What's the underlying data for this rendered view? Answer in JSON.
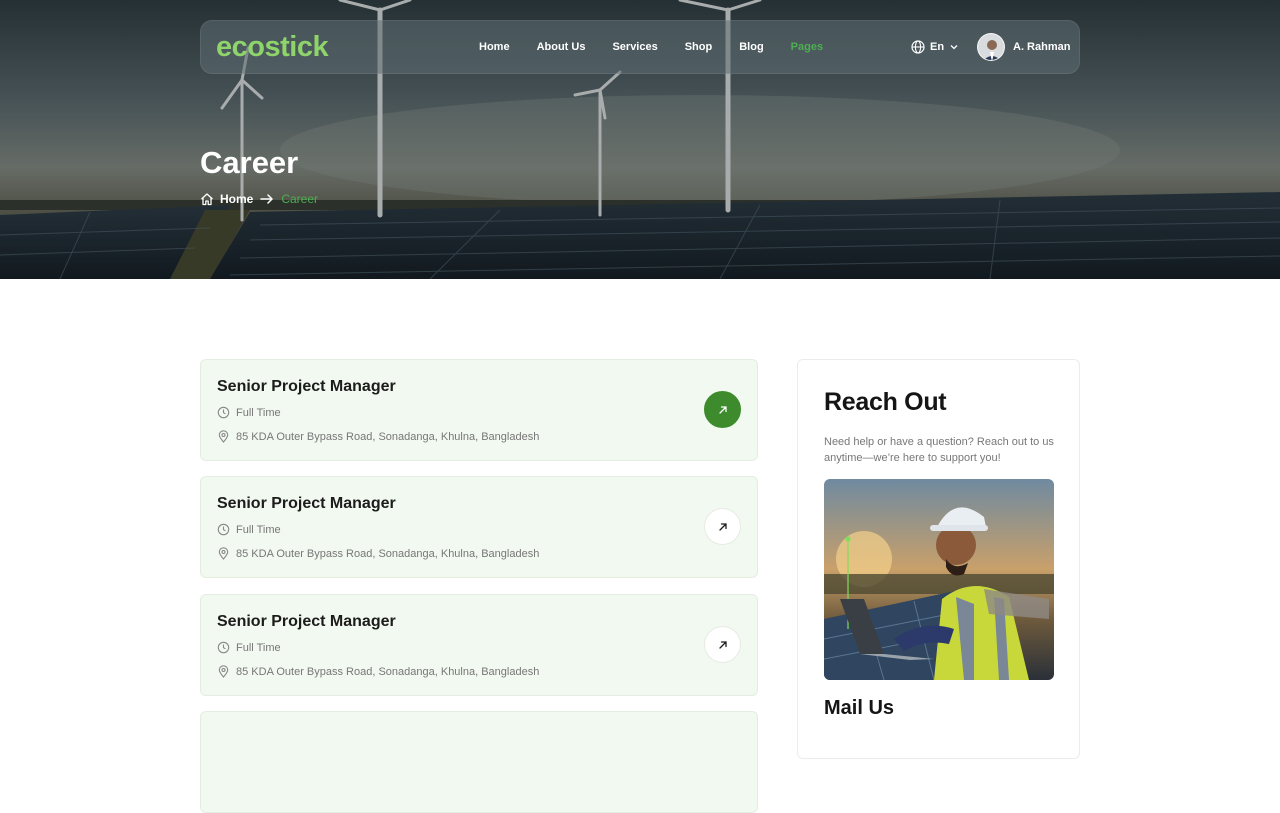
{
  "brand": {
    "logo_text": "ecostick",
    "accent_color": "#4caf50",
    "button_color": "#3d8b2c"
  },
  "nav": {
    "items": [
      {
        "label": "Home",
        "active": false
      },
      {
        "label": "About Us",
        "active": false
      },
      {
        "label": "Services",
        "active": false
      },
      {
        "label": "Shop",
        "active": false
      },
      {
        "label": "Blog",
        "active": false
      },
      {
        "label": "Pages",
        "active": true
      }
    ],
    "language": {
      "label": "En",
      "icon": "globe-icon"
    },
    "user": {
      "name": "A. Rahman"
    }
  },
  "hero": {
    "title": "Career",
    "breadcrumb": {
      "home": "Home",
      "current": "Career"
    }
  },
  "jobs": [
    {
      "title": "Senior Project Manager",
      "type": "Full Time",
      "location": "85 KDA Outer Bypass Road, Sonadanga, Khulna, Bangladesh",
      "highlighted": true
    },
    {
      "title": "Senior Project Manager",
      "type": "Full Time",
      "location": "85 KDA Outer Bypass Road, Sonadanga, Khulna, Bangladesh",
      "highlighted": false
    },
    {
      "title": "Senior Project Manager",
      "type": "Full Time",
      "location": "85 KDA Outer Bypass Road, Sonadanga, Khulna, Bangladesh",
      "highlighted": false
    }
  ],
  "sidebar": {
    "title": "Reach Out",
    "text": "Need help or have a question? Reach out to us anytime—we’re here to support you!",
    "mail_title": "Mail Us"
  }
}
